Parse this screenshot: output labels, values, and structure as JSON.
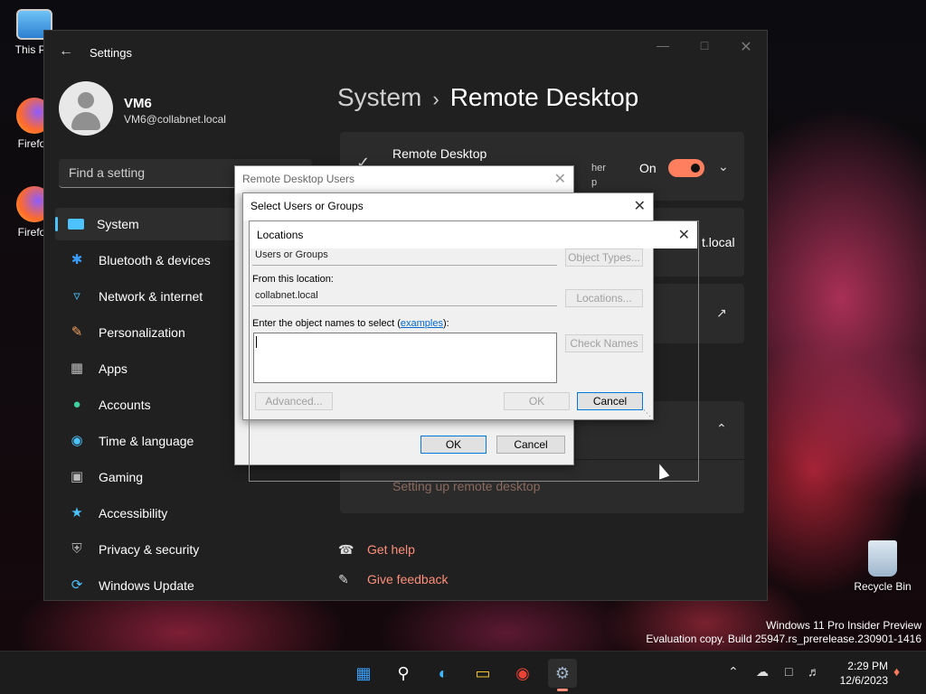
{
  "desktop": {
    "icons": [
      {
        "label": "This PC"
      },
      {
        "label": "Firefox"
      },
      {
        "label": "Firefox"
      },
      {
        "label": "Recycle Bin"
      }
    ],
    "watermark_line1": "Windows 11 Pro Insider Preview",
    "watermark_line2": "Evaluation copy. Build 25947.rs_prerelease.230901-1416"
  },
  "settings": {
    "app_title": "Settings",
    "user": {
      "name": "VM6",
      "email": "VM6@collabnet.local"
    },
    "search_placeholder": "Find a setting",
    "nav": [
      {
        "label": "System",
        "icon": "system-icon",
        "active": true
      },
      {
        "label": "Bluetooth & devices",
        "icon": "bluetooth-icon"
      },
      {
        "label": "Network & internet",
        "icon": "wifi-icon"
      },
      {
        "label": "Personalization",
        "icon": "brush-icon"
      },
      {
        "label": "Apps",
        "icon": "apps-icon"
      },
      {
        "label": "Accounts",
        "icon": "person-icon"
      },
      {
        "label": "Time & language",
        "icon": "globe-icon"
      },
      {
        "label": "Gaming",
        "icon": "gamepad-icon"
      },
      {
        "label": "Accessibility",
        "icon": "accessibility-icon"
      },
      {
        "label": "Privacy & security",
        "icon": "shield-icon"
      },
      {
        "label": "Windows Update",
        "icon": "update-icon"
      }
    ],
    "breadcrumb": {
      "parent": "System",
      "current": "Remote Desktop"
    },
    "remote_desktop": {
      "label": "Remote Desktop",
      "subtitle_tail": "her",
      "subtitle_tail2": "p",
      "state": "On"
    },
    "pc_name_tail": "t.local",
    "setting_up_link": "Setting up remote desktop",
    "help": "Get help",
    "feedback": "Give feedback"
  },
  "dialog_rdu": {
    "title": "Remote Desktop Users",
    "ok": "OK",
    "cancel": "Cancel"
  },
  "dialog_select": {
    "title": "Select Users or Groups"
  },
  "dialog_locations": {
    "title": "Locations",
    "object_types_value": "Users or Groups",
    "object_types_button": "Object Types...",
    "from_location_label": "From this location:",
    "location_value": "collabnet.local",
    "locations_button": "Locations...",
    "enter_names_label": "Enter the object names to select (",
    "examples_link": "examples",
    "enter_names_label_tail": "):",
    "check_names_button": "Check Names",
    "advanced_button": "Advanced...",
    "ok": "OK",
    "cancel": "Cancel"
  },
  "taskbar": {
    "time": "2:29 PM",
    "date": "12/6/2023"
  }
}
